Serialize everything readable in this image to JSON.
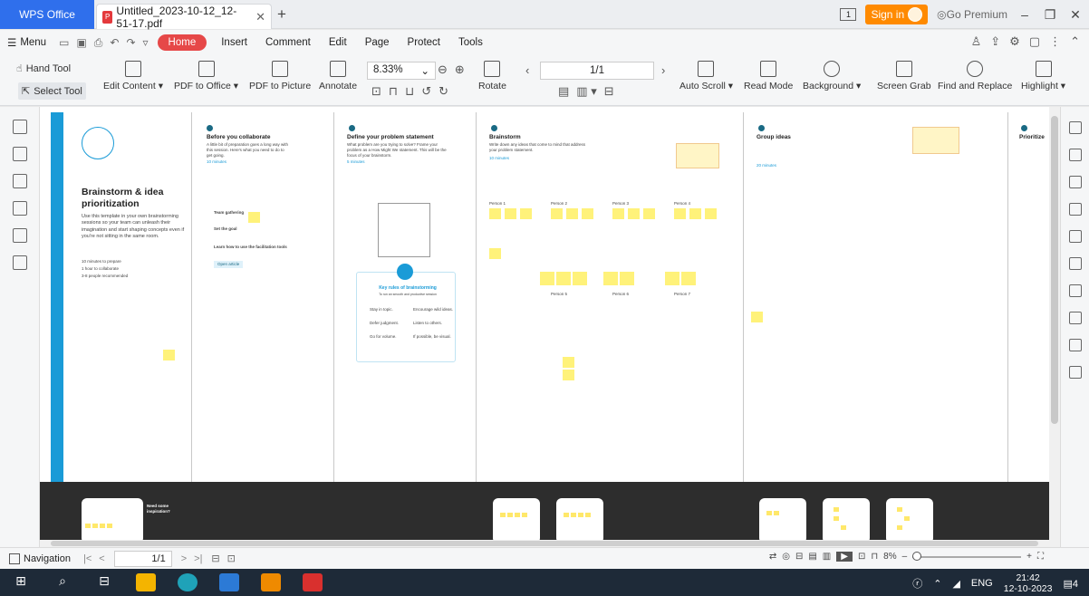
{
  "titlebar": {
    "app_name": "WPS Office",
    "doc_tab": "Untitled_2023-10-12_12-51-17.pdf",
    "sign_in": "Sign in",
    "go_premium": "Go Premium"
  },
  "menubar": {
    "menu": "Menu",
    "tabs": [
      "Home",
      "Insert",
      "Comment",
      "Edit",
      "Page",
      "Protect",
      "Tools"
    ]
  },
  "ribbon": {
    "hand_tool": "Hand Tool",
    "select_tool": "Select Tool",
    "edit_content": "Edit Content",
    "pdf_to_office": "PDF to Office",
    "pdf_to_picture": "PDF to Picture",
    "annotate": "Annotate",
    "zoom": "8.33%",
    "rotate": "Rotate",
    "page": "1/1",
    "auto_scroll": "Auto Scroll",
    "read_mode": "Read Mode",
    "background": "Background",
    "screen_grab": "Screen Grab",
    "find_replace": "Find and Replace",
    "highlight": "Highlight"
  },
  "canvas": {
    "panel1": {
      "title": "Brainstorm & idea prioritization",
      "body": "Use this template in your own brainstorming sessions so your team can unleash their imagination and start shaping concepts even if you're not sitting in the same room.",
      "meta": [
        "10 minutes to prepare",
        "1 hour to collaborate",
        "3-8 people recommended"
      ]
    },
    "panel2": {
      "title": "Before you collaborate",
      "body": "A little bit of preparation goes a long way with this session. Here's what you need to do to get going.",
      "time": "10 minutes",
      "steps": [
        "Team gathering",
        "Set the goal",
        "Learn how to use the facilitation tools"
      ],
      "link": "Open article"
    },
    "panel3": {
      "title": "Define your problem statement",
      "body": "What problem are you trying to solve? Frame your problem as a How Might We statement. This will be the focus of your brainstorm.",
      "time": "5 minutes",
      "rules_title": "Key rules of brainstorming",
      "rules_sub": "To run an smooth and productive session",
      "rules": [
        "Stay in topic.",
        "Encourage wild ideas.",
        "Defer judgment.",
        "Listen to others.",
        "Go for volume.",
        "If possible, be visual."
      ]
    },
    "panel4": {
      "title": "Brainstorm",
      "body": "Write down any ideas that come to mind that address your problem statement.",
      "time": "10 minutes",
      "persons": [
        "Person 1",
        "Person 2",
        "Person 3",
        "Person 4",
        "Person 5",
        "Person 6",
        "Person 7",
        "Person 8"
      ]
    },
    "panel5": {
      "title": "Group ideas",
      "time": "20 minutes"
    },
    "panel6": {
      "title": "Prioritize"
    },
    "footer_card": "Need some inspiration?"
  },
  "statusbar": {
    "navigation": "Navigation",
    "page": "1/1",
    "zoom": "8%"
  },
  "taskbar": {
    "lang": "ENG",
    "time": "21:42",
    "date": "12-10-2023",
    "badge": "4"
  },
  "colors": {
    "accent_blue": "#2f6fec",
    "home_red": "#e64848",
    "sign_in_orange": "#ff8a00",
    "template_blue": "#1a9bd7",
    "sticky_yellow": "#fff27a"
  }
}
